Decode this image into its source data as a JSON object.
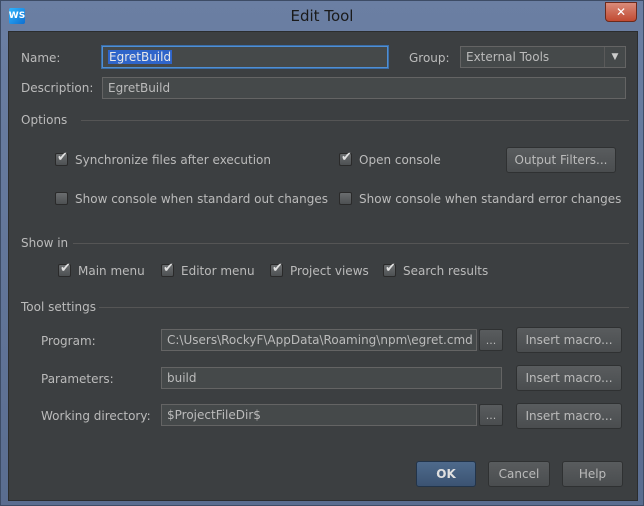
{
  "window": {
    "title": "Edit Tool",
    "app_icon_text": "WS",
    "close_glyph": "✕"
  },
  "form": {
    "name_label": "Name:",
    "name_value": "EgretBuild",
    "group_label": "Group:",
    "group_value": "External Tools",
    "description_label": "Description:",
    "description_value": "EgretBuild"
  },
  "options": {
    "title": "Options",
    "sync_files": "Synchronize files after execution",
    "open_console": "Open console",
    "output_filters_label": "Output Filters...",
    "show_console_stdout": "Show console when standard out changes",
    "show_console_stderr": "Show console when standard error changes"
  },
  "show_in": {
    "title": "Show in",
    "main_menu": "Main menu",
    "editor_menu": "Editor menu",
    "project_views": "Project views",
    "search_results": "Search results"
  },
  "tool_settings": {
    "title": "Tool settings",
    "program_label": "Program:",
    "program_value": "C:\\Users\\RockyF\\AppData\\Roaming\\npm\\egret.cmd",
    "parameters_label": "Parameters:",
    "parameters_value": "build",
    "working_dir_label": "Working directory:",
    "working_dir_value": "$ProjectFileDir$",
    "insert_macro_label": "Insert macro...",
    "browse_label": "..."
  },
  "footer": {
    "ok_label": "OK",
    "cancel_label": "Cancel",
    "help_label": "Help"
  },
  "colors": {
    "accent": "#2f65ca",
    "panel_bg": "#3c3f41",
    "text": "#bbbbbb"
  }
}
